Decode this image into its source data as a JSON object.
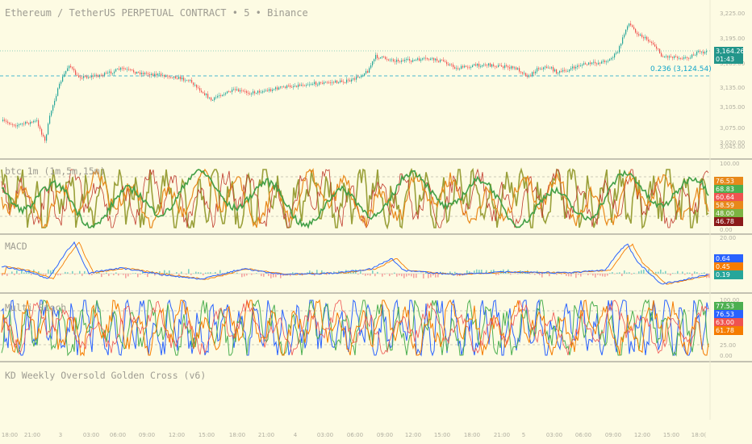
{
  "chart_title": "Ethereum / TetherUS PERPETUAL CONTRACT • 5 • Binance",
  "price_pane": {
    "y_ticks": [
      "3,225.00",
      "3,195.00",
      "3,165.00",
      "3,135.00",
      "3,105.00",
      "3,075.00",
      "3,045.00",
      "3,020.00"
    ],
    "last_price": "3,164.26",
    "countdown": "01:43",
    "fib_label": "0.236 (3,124.54)",
    "colors": {
      "up": "#26a69a",
      "down": "#ef5350",
      "fib": "#11a5c9",
      "price_line": "#26a69a"
    }
  },
  "panes": {
    "btc": {
      "label": "btc_1m (1m,5m,15m)",
      "y_ticks": [
        "100.00",
        "50.00",
        "0.00"
      ],
      "badges": [
        {
          "text": "76.53",
          "color": "#e8891a"
        },
        {
          "text": "68.83",
          "color": "#4caf50"
        },
        {
          "text": "60.64",
          "color": "#ef5350"
        },
        {
          "text": "58.59",
          "color": "#e8891a"
        },
        {
          "text": "48.00",
          "color": "#7cb342"
        },
        {
          "text": "46.78",
          "color": "#8b1a1a"
        }
      ]
    },
    "macd": {
      "label": "MACD",
      "y_ticks": [
        "20.00"
      ],
      "badges": [
        {
          "text": "0.64",
          "color": "#2962ff"
        },
        {
          "text": "0.45",
          "color": "#f57c00"
        },
        {
          "text": "0.19",
          "color": "#26a69a"
        }
      ]
    },
    "stoch": {
      "label": "Multi Stoch",
      "y_ticks": [
        "100.00",
        "75.00",
        "25.00",
        "0.00"
      ],
      "badges": [
        {
          "text": "77.53",
          "color": "#4caf50"
        },
        {
          "text": "76.53",
          "color": "#2962ff"
        },
        {
          "text": "63.00",
          "color": "#ef5350"
        },
        {
          "text": "61.78",
          "color": "#f57c00"
        }
      ]
    },
    "kd": {
      "label": "KD Weekly Oversold Golden Cross (v6)"
    }
  },
  "time_axis": [
    "18:00",
    "21:00",
    "3",
    "03:00",
    "06:00",
    "09:00",
    "12:00",
    "15:00",
    "18:00",
    "21:00",
    "4",
    "03:00",
    "06:00",
    "09:00",
    "12:00",
    "15:00",
    "18:00",
    "21:00",
    "5",
    "03:00",
    "06:00",
    "09:00",
    "12:00",
    "15:00",
    "18:0("
  ]
}
